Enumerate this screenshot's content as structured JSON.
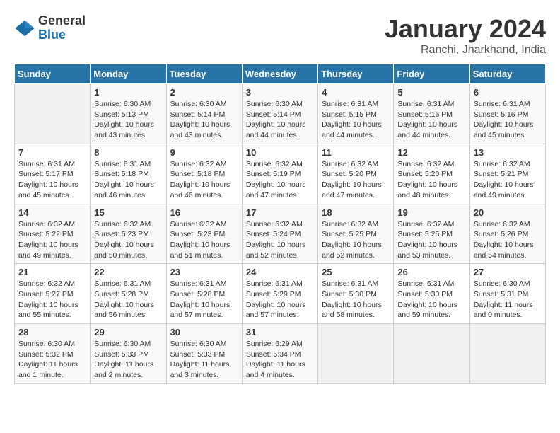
{
  "header": {
    "logo_general": "General",
    "logo_blue": "Blue",
    "month_year": "January 2024",
    "location": "Ranchi, Jharkhand, India"
  },
  "days_of_week": [
    "Sunday",
    "Monday",
    "Tuesday",
    "Wednesday",
    "Thursday",
    "Friday",
    "Saturday"
  ],
  "weeks": [
    [
      {
        "day": "",
        "info": ""
      },
      {
        "day": "1",
        "info": "Sunrise: 6:30 AM\nSunset: 5:13 PM\nDaylight: 10 hours\nand 43 minutes."
      },
      {
        "day": "2",
        "info": "Sunrise: 6:30 AM\nSunset: 5:14 PM\nDaylight: 10 hours\nand 43 minutes."
      },
      {
        "day": "3",
        "info": "Sunrise: 6:30 AM\nSunset: 5:14 PM\nDaylight: 10 hours\nand 44 minutes."
      },
      {
        "day": "4",
        "info": "Sunrise: 6:31 AM\nSunset: 5:15 PM\nDaylight: 10 hours\nand 44 minutes."
      },
      {
        "day": "5",
        "info": "Sunrise: 6:31 AM\nSunset: 5:16 PM\nDaylight: 10 hours\nand 44 minutes."
      },
      {
        "day": "6",
        "info": "Sunrise: 6:31 AM\nSunset: 5:16 PM\nDaylight: 10 hours\nand 45 minutes."
      }
    ],
    [
      {
        "day": "7",
        "info": "Sunrise: 6:31 AM\nSunset: 5:17 PM\nDaylight: 10 hours\nand 45 minutes."
      },
      {
        "day": "8",
        "info": "Sunrise: 6:31 AM\nSunset: 5:18 PM\nDaylight: 10 hours\nand 46 minutes."
      },
      {
        "day": "9",
        "info": "Sunrise: 6:32 AM\nSunset: 5:18 PM\nDaylight: 10 hours\nand 46 minutes."
      },
      {
        "day": "10",
        "info": "Sunrise: 6:32 AM\nSunset: 5:19 PM\nDaylight: 10 hours\nand 47 minutes."
      },
      {
        "day": "11",
        "info": "Sunrise: 6:32 AM\nSunset: 5:20 PM\nDaylight: 10 hours\nand 47 minutes."
      },
      {
        "day": "12",
        "info": "Sunrise: 6:32 AM\nSunset: 5:20 PM\nDaylight: 10 hours\nand 48 minutes."
      },
      {
        "day": "13",
        "info": "Sunrise: 6:32 AM\nSunset: 5:21 PM\nDaylight: 10 hours\nand 49 minutes."
      }
    ],
    [
      {
        "day": "14",
        "info": "Sunrise: 6:32 AM\nSunset: 5:22 PM\nDaylight: 10 hours\nand 49 minutes."
      },
      {
        "day": "15",
        "info": "Sunrise: 6:32 AM\nSunset: 5:23 PM\nDaylight: 10 hours\nand 50 minutes."
      },
      {
        "day": "16",
        "info": "Sunrise: 6:32 AM\nSunset: 5:23 PM\nDaylight: 10 hours\nand 51 minutes."
      },
      {
        "day": "17",
        "info": "Sunrise: 6:32 AM\nSunset: 5:24 PM\nDaylight: 10 hours\nand 52 minutes."
      },
      {
        "day": "18",
        "info": "Sunrise: 6:32 AM\nSunset: 5:25 PM\nDaylight: 10 hours\nand 52 minutes."
      },
      {
        "day": "19",
        "info": "Sunrise: 6:32 AM\nSunset: 5:25 PM\nDaylight: 10 hours\nand 53 minutes."
      },
      {
        "day": "20",
        "info": "Sunrise: 6:32 AM\nSunset: 5:26 PM\nDaylight: 10 hours\nand 54 minutes."
      }
    ],
    [
      {
        "day": "21",
        "info": "Sunrise: 6:32 AM\nSunset: 5:27 PM\nDaylight: 10 hours\nand 55 minutes."
      },
      {
        "day": "22",
        "info": "Sunrise: 6:31 AM\nSunset: 5:28 PM\nDaylight: 10 hours\nand 56 minutes."
      },
      {
        "day": "23",
        "info": "Sunrise: 6:31 AM\nSunset: 5:28 PM\nDaylight: 10 hours\nand 57 minutes."
      },
      {
        "day": "24",
        "info": "Sunrise: 6:31 AM\nSunset: 5:29 PM\nDaylight: 10 hours\nand 57 minutes."
      },
      {
        "day": "25",
        "info": "Sunrise: 6:31 AM\nSunset: 5:30 PM\nDaylight: 10 hours\nand 58 minutes."
      },
      {
        "day": "26",
        "info": "Sunrise: 6:31 AM\nSunset: 5:30 PM\nDaylight: 10 hours\nand 59 minutes."
      },
      {
        "day": "27",
        "info": "Sunrise: 6:30 AM\nSunset: 5:31 PM\nDaylight: 11 hours\nand 0 minutes."
      }
    ],
    [
      {
        "day": "28",
        "info": "Sunrise: 6:30 AM\nSunset: 5:32 PM\nDaylight: 11 hours\nand 1 minute."
      },
      {
        "day": "29",
        "info": "Sunrise: 6:30 AM\nSunset: 5:33 PM\nDaylight: 11 hours\nand 2 minutes."
      },
      {
        "day": "30",
        "info": "Sunrise: 6:30 AM\nSunset: 5:33 PM\nDaylight: 11 hours\nand 3 minutes."
      },
      {
        "day": "31",
        "info": "Sunrise: 6:29 AM\nSunset: 5:34 PM\nDaylight: 11 hours\nand 4 minutes."
      },
      {
        "day": "",
        "info": ""
      },
      {
        "day": "",
        "info": ""
      },
      {
        "day": "",
        "info": ""
      }
    ]
  ]
}
